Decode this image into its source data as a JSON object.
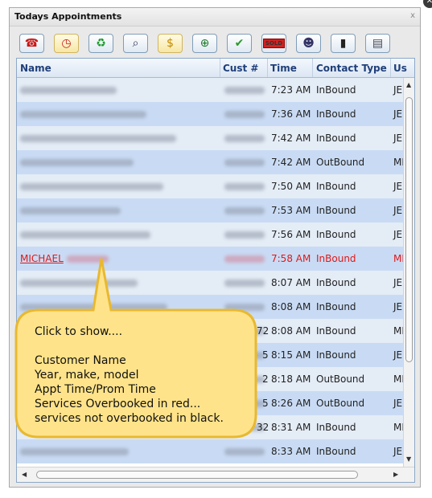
{
  "window": {
    "title": "Todays Appointments",
    "close_label": "x"
  },
  "toolbar": {
    "buttons": [
      {
        "name": "phone",
        "glyph": "☎"
      },
      {
        "name": "clock",
        "glyph": "◷"
      },
      {
        "name": "recycle",
        "glyph": "♻"
      },
      {
        "name": "search",
        "glyph": "⌕"
      },
      {
        "name": "dollar",
        "glyph": "$"
      },
      {
        "name": "globe-add",
        "glyph": "⊕"
      },
      {
        "name": "check",
        "glyph": "✔"
      },
      {
        "name": "sold",
        "label": "SOLD"
      },
      {
        "name": "add-user",
        "glyph": "☻"
      },
      {
        "name": "bookmark",
        "glyph": "▮"
      },
      {
        "name": "report",
        "glyph": "▤"
      }
    ]
  },
  "grid": {
    "columns": [
      "Name",
      "Cust #",
      "Time",
      "Contact Type",
      "Us"
    ],
    "rows": [
      {
        "name": "",
        "time": "7:23 AM",
        "contact": "InBound",
        "user": "JE",
        "red": false
      },
      {
        "name": "",
        "time": "7:36 AM",
        "contact": "InBound",
        "user": "JE",
        "red": false
      },
      {
        "name": "",
        "time": "7:42 AM",
        "contact": "InBound",
        "user": "JE",
        "red": false
      },
      {
        "name": "",
        "time": "7:42 AM",
        "contact": "OutBound",
        "user": "MI",
        "red": false
      },
      {
        "name": "",
        "time": "7:50 AM",
        "contact": "InBound",
        "user": "JE",
        "red": false
      },
      {
        "name": "",
        "time": "7:53 AM",
        "contact": "InBound",
        "user": "JE",
        "red": false
      },
      {
        "name": "",
        "time": "7:56 AM",
        "contact": "InBound",
        "user": "JE",
        "red": false
      },
      {
        "name": "MICHAEL",
        "time": "7:58 AM",
        "contact": "InBound",
        "user": "MI",
        "red": true
      },
      {
        "name": "",
        "time": "8:07 AM",
        "contact": "InBound",
        "user": "JE",
        "red": false
      },
      {
        "name": "",
        "time": "8:08 AM",
        "contact": "InBound",
        "user": "JE",
        "red": false
      },
      {
        "name": "",
        "cust_suffix": "72",
        "time": "8:08 AM",
        "contact": "InBound",
        "user": "MI",
        "red": false
      },
      {
        "name": "",
        "cust_suffix": "5",
        "time": "8:15 AM",
        "contact": "InBound",
        "user": "JE",
        "red": false
      },
      {
        "name": "",
        "cust_suffix": "2",
        "time": "8:18 AM",
        "contact": "OutBound",
        "user": "MI",
        "red": false
      },
      {
        "name": "",
        "cust_suffix": "5",
        "time": "8:26 AM",
        "contact": "OutBound",
        "user": "JE",
        "red": false
      },
      {
        "name": "",
        "cust_suffix": "32",
        "time": "8:31 AM",
        "contact": "InBound",
        "user": "MI",
        "red": false
      },
      {
        "name": "",
        "time": "8:33 AM",
        "contact": "InBound",
        "user": "JE",
        "red": false
      }
    ]
  },
  "callout": {
    "lines": [
      "Click to show....",
      "",
      "Customer Name",
      "Year, make, model",
      "Appt Time/Prom Time",
      "Services Overbooked in red...",
      "services not overbooked in black."
    ],
    "fill_color": "#ffe38a",
    "border_color": "#e8b930"
  },
  "colors": {
    "row_a": "#e4ecf6",
    "row_b": "#c9dbf4",
    "overbooked": "#e01818",
    "header_text": "#1f3f7a"
  }
}
